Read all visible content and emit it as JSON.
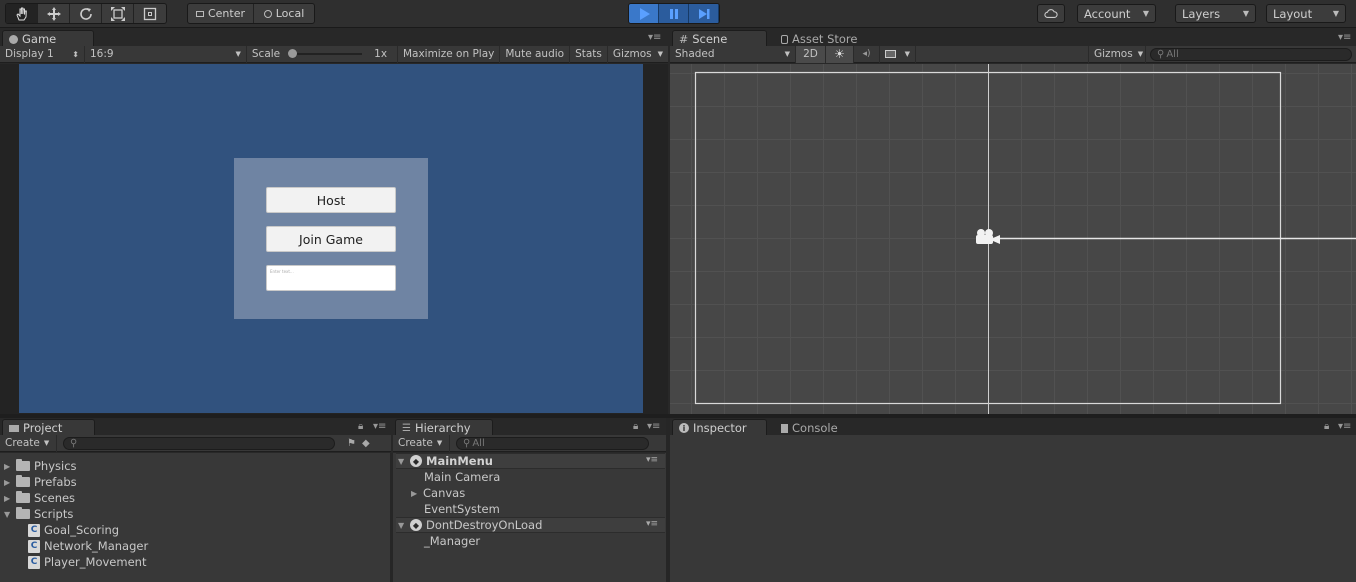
{
  "toolbar": {
    "pivot_center": "Center",
    "pivot_local": "Local",
    "account": "Account",
    "layers": "Layers",
    "layout": "Layout"
  },
  "game": {
    "tab": "Game",
    "display": "Display 1",
    "aspect": "16:9",
    "scale_label": "Scale",
    "scale_value": "1x",
    "maximize": "Maximize on Play",
    "mute": "Mute audio",
    "stats": "Stats",
    "gizmos": "Gizmos",
    "menu": {
      "host": "Host",
      "join": "Join Game",
      "input_placeholder": "Enter text..."
    }
  },
  "scene": {
    "tab": "Scene",
    "asset_store_tab": "Asset Store",
    "shading": "Shaded",
    "mode_2d": "2D",
    "gizmos": "Gizmos",
    "search_placeholder": "All"
  },
  "project": {
    "tab": "Project",
    "create": "Create",
    "items": [
      {
        "label": "Physics",
        "type": "folder"
      },
      {
        "label": "Prefabs",
        "type": "folder"
      },
      {
        "label": "Scenes",
        "type": "folder"
      },
      {
        "label": "Scripts",
        "type": "folder-open"
      },
      {
        "label": "Goal_Scoring",
        "type": "script"
      },
      {
        "label": "Network_Manager",
        "type": "script"
      },
      {
        "label": "Player_Movement",
        "type": "script"
      }
    ]
  },
  "hierarchy": {
    "tab": "Hierarchy",
    "create": "Create",
    "search_placeholder": "All",
    "scene1": "MainMenu",
    "scene1_items": [
      "Main Camera",
      "Canvas",
      "EventSystem"
    ],
    "scene2": "DontDestroyOnLoad",
    "scene2_items": [
      "_Manager"
    ]
  },
  "inspector": {
    "tab": "Inspector",
    "console_tab": "Console"
  },
  "colors": {
    "game_bg": "#31527e",
    "menu_panel": "#6f84a3",
    "play_active": "#3a78c9",
    "scene_bg": "#474747"
  }
}
